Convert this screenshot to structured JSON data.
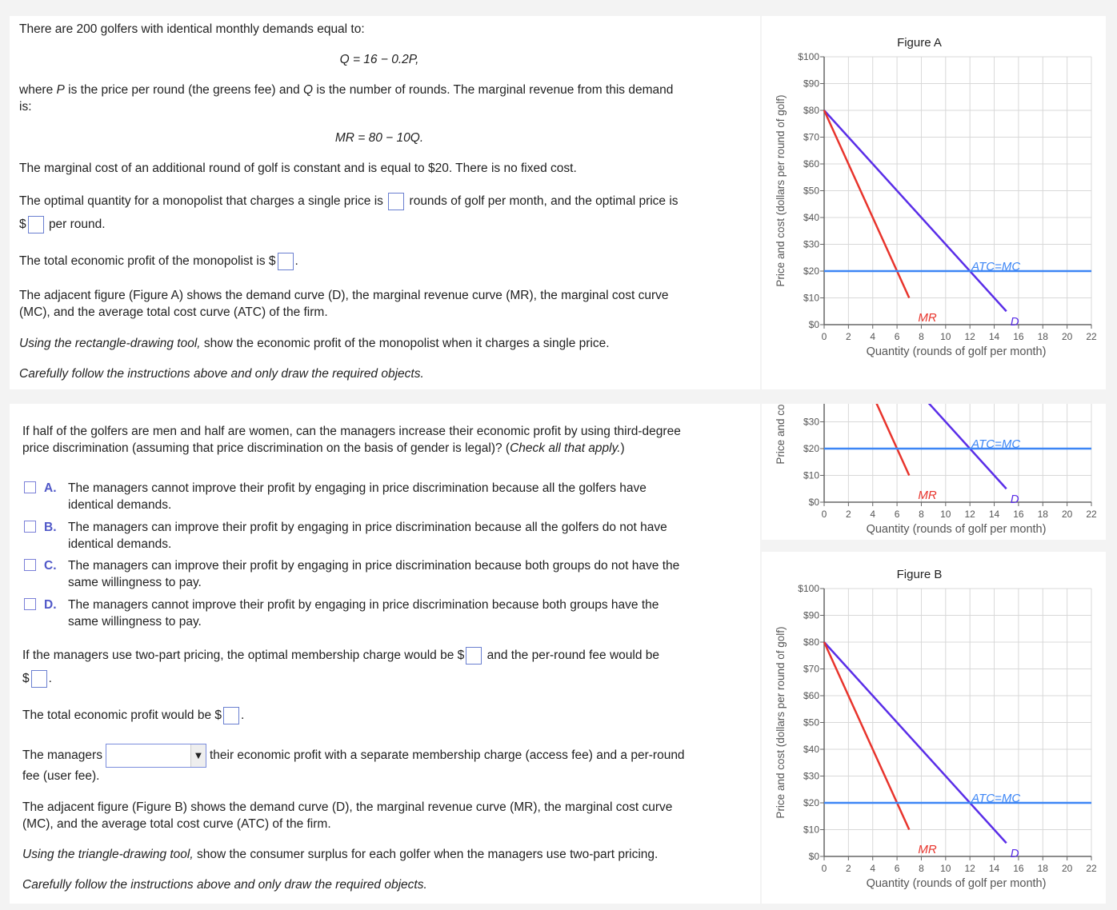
{
  "part1": {
    "intro": "There are 200 golfers with identical monthly demands equal to:",
    "demand_eq": "Q = 16 − 0.2P,",
    "where_a": "where ",
    "P": "P",
    "where_b": " is the price per round (the greens fee) and ",
    "Q": "Q",
    "where_c": " is the number of rounds. The marginal revenue from this demand",
    "where_d": "is:",
    "mr_eq": "MR = 80 − 10Q.",
    "mc_text": "The marginal cost of an additional round of golf is constant and is equal to $20. There is no fixed cost.",
    "opt_a": "The optimal quantity for a monopolist that charges a single price is",
    "opt_b": "rounds of golf per month, and the optimal price is",
    "opt_c": "$",
    "opt_d": "per round.",
    "profit_a": "The total economic profit of the monopolist is $",
    "profit_b": ".",
    "fig_a1": "The adjacent figure (Figure A) shows the demand curve (D), the marginal revenue curve (MR), the marginal cost curve",
    "fig_a2": "(MC), and the average total cost curve (ATC) of the firm.",
    "instr1_a": "Using the rectangle-drawing tool,",
    "instr1_b": " show the economic profit of the monopolist when it charges a single price.",
    "careful": "Carefully follow the instructions above and only draw the required objects."
  },
  "part2": {
    "q1": "If half of the golfers are men and half are women, can the managers increase their economic profit by using third-degree",
    "q2a": "price discrimination (assuming that price discrimination on the basis of gender is legal)? (",
    "q2b": "Check all that apply.",
    "q2c": ")",
    "options": [
      {
        "letter": "A.",
        "l1": "The managers cannot improve their profit by engaging in price discrimination because all the golfers have",
        "l2": "identical demands.",
        "checked": false
      },
      {
        "letter": "B.",
        "l1": "The managers can improve their profit by engaging in price discrimination because all the golfers do not have",
        "l2": "identical demands.",
        "checked": false
      },
      {
        "letter": "C.",
        "l1": "The managers can improve their profit by engaging in price discrimination because both groups do not have the",
        "l2": "same willingness to pay.",
        "checked": false
      },
      {
        "letter": "D.",
        "l1": "The managers cannot improve their profit by engaging in price discrimination because both groups have the",
        "l2": "same willingness to pay.",
        "checked": false
      }
    ],
    "tp_a": "If the managers use two-part pricing, the optimal membership charge would be $",
    "tp_b": "and the per-round fee would be",
    "tp_c": "$",
    "tp_d": ".",
    "tot_a": "The total economic profit would be $",
    "tot_b": ".",
    "mgr_a": "The managers",
    "mgr_select": "",
    "mgr_b": "their economic profit with a separate membership charge (access fee) and a per-round",
    "mgr_c": "fee (user fee).",
    "fig_b1": "The adjacent figure (Figure B) shows the demand curve (D), the marginal revenue curve (MR), the marginal cost curve",
    "fig_b2": "(MC), and the average total cost curve (ATC) of the firm.",
    "instr2_a": "Using the triangle-drawing tool,",
    "instr2_b": " show the consumer surplus for each golfer when the managers use two-part pricing.",
    "careful": "Carefully follow the instructions above and only draw the required objects."
  },
  "chart_data": [
    {
      "type": "line",
      "title": "Figure A",
      "xlabel": "Quantity (rounds of golf per month)",
      "ylabel": "Price and cost (dollars per round of golf)",
      "xlim": [
        0,
        22
      ],
      "ylim": [
        0,
        100
      ],
      "xticks": [
        "0",
        "2",
        "4",
        "6",
        "8",
        "10",
        "12",
        "14",
        "16",
        "18",
        "20",
        "22"
      ],
      "yticks": [
        "$0",
        "$10",
        "$20",
        "$30",
        "$40",
        "$50",
        "$60",
        "$70",
        "$80",
        "$90",
        "$100"
      ],
      "grid": true,
      "series": [
        {
          "name": "D",
          "color": "#5a2ee8",
          "points": [
            [
              0,
              80
            ],
            [
              15,
              5
            ]
          ]
        },
        {
          "name": "MR",
          "color": "#e8342c",
          "points": [
            [
              0,
              80
            ],
            [
              7,
              10
            ]
          ]
        },
        {
          "name": "ATC=MC",
          "color": "#3d86f5",
          "points": [
            [
              0,
              20
            ],
            [
              22,
              20
            ]
          ]
        }
      ]
    },
    {
      "type": "line",
      "title": "Figure A",
      "xlabel": "Quantity (rounds of golf per month)",
      "ylabel": "Price and cost (dollars per round of golf)",
      "xlim": [
        0,
        22
      ],
      "ylim": [
        0,
        100
      ],
      "xticks": [
        "0",
        "2",
        "4",
        "6",
        "8",
        "10",
        "12",
        "14",
        "16",
        "18",
        "20",
        "22"
      ],
      "yticks": [
        "$0",
        "$10",
        "$20",
        "$30",
        "$40",
        "$50",
        "$60",
        "$70",
        "$80",
        "$90",
        "$100"
      ],
      "grid": true,
      "series": [
        {
          "name": "D",
          "color": "#5a2ee8",
          "points": [
            [
              0,
              80
            ],
            [
              15,
              5
            ]
          ]
        },
        {
          "name": "MR",
          "color": "#e8342c",
          "points": [
            [
              0,
              80
            ],
            [
              7,
              10
            ]
          ]
        },
        {
          "name": "ATC=MC",
          "color": "#3d86f5",
          "points": [
            [
              0,
              20
            ],
            [
              22,
              20
            ]
          ]
        }
      ]
    },
    {
      "type": "line",
      "title": "Figure B",
      "xlabel": "Quantity (rounds of golf per month)",
      "ylabel": "Price and cost (dollars per round of golf)",
      "xlim": [
        0,
        22
      ],
      "ylim": [
        0,
        100
      ],
      "xticks": [
        "0",
        "2",
        "4",
        "6",
        "8",
        "10",
        "12",
        "14",
        "16",
        "18",
        "20",
        "22"
      ],
      "yticks": [
        "$0",
        "$10",
        "$20",
        "$30",
        "$40",
        "$50",
        "$60",
        "$70",
        "$80",
        "$90",
        "$100"
      ],
      "grid": true,
      "series": [
        {
          "name": "D",
          "color": "#5a2ee8",
          "points": [
            [
              0,
              80
            ],
            [
              15,
              5
            ]
          ]
        },
        {
          "name": "MR",
          "color": "#e8342c",
          "points": [
            [
              0,
              80
            ],
            [
              7,
              10
            ]
          ]
        },
        {
          "name": "ATC=MC",
          "color": "#3d86f5",
          "points": [
            [
              0,
              20
            ],
            [
              22,
              20
            ]
          ]
        }
      ]
    }
  ]
}
